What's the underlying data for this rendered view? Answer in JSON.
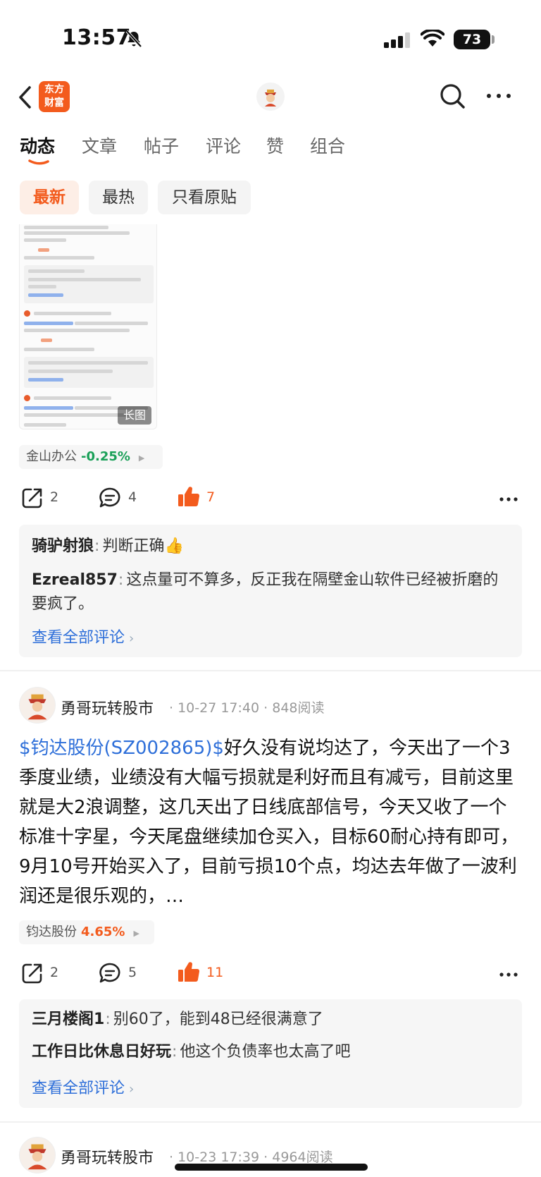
{
  "status_bar": {
    "time": "13:57",
    "battery": "73"
  },
  "header": {
    "logo_line1": "东方",
    "logo_line2": "财富"
  },
  "tabs": [
    "动态",
    "文章",
    "帖子",
    "评论",
    "赞",
    "组合"
  ],
  "filters": [
    "最新",
    "最热",
    "只看原贴"
  ],
  "post1": {
    "image_badge": "长图",
    "stock_name": "金山办公",
    "stock_change": "-0.25%",
    "stock_change_color": "#1aa058",
    "share_count": "2",
    "comment_count": "4",
    "like_count": "7",
    "comments": [
      {
        "user": "骑驴射狼",
        "text": "判断正确👍"
      },
      {
        "user": "Ezreal857",
        "text": "这点量可不算多，反正我在隔壁金山软件已经被折磨的要疯了。"
      }
    ],
    "see_all": "查看全部评论"
  },
  "post2": {
    "user": "勇哥玩转股市",
    "time": "10-27 17:40",
    "reads": "848阅读",
    "stock_link": "$钧达股份(SZ002865)$",
    "text": "好久没有说均达了，今天出了一个3季度业绩，业绩没有大幅亏损就是利好而且有减亏，目前这里就是大2浪调整，这几天出了日线底部信号，今天又收了一个标准十字星，今天尾盘继续加仓买入，目标60耐心持有即可，9月10号开始买入了，目前亏损10个点，均达去年做了一波利润还是很乐观的，…",
    "stock_name": "钧达股份",
    "stock_change": "4.65%",
    "stock_change_color": "#f35b1d",
    "share_count": "2",
    "comment_count": "5",
    "like_count": "11",
    "comments": [
      {
        "user": "三月楼阁1",
        "text": "别60了，能到48已经很满意了"
      },
      {
        "user": "工作日比休息日好玩",
        "text": "他这个负债率也太高了吧"
      }
    ],
    "see_all": "查看全部评论"
  },
  "post3": {
    "user": "勇哥玩转股市",
    "time": "10-23 17:39",
    "reads": "4964阅读"
  },
  "colors": {
    "accent": "#f35b1d",
    "link": "#2e6fd9",
    "down": "#1aa058"
  }
}
